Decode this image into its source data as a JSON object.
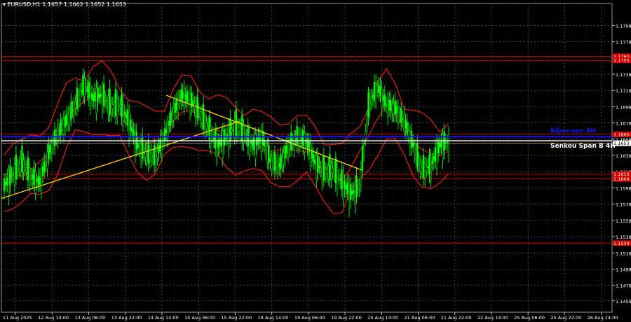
{
  "header": {
    "symbol_line": "EURUSD,H1  1.1657 1.1662 1.1652 1.1653"
  },
  "colors": {
    "background": "#000000",
    "grid": "#6b6b6b",
    "candle": "#00ff00",
    "ichimoku": "#ff1a1a",
    "trendline": "#ffd700",
    "level_red": "#d20000",
    "kijun_blue": "#1414ff",
    "senkou_white": "#ffffff",
    "price_tag": "#ffffff"
  },
  "chart_data": {
    "type": "candlestick",
    "ylim": [
      1.1445,
      1.1825
    ],
    "y_ticks": [
      "1.1798",
      "1.1778",
      "1.1758",
      "1.1738",
      "1.1718",
      "1.1698",
      "1.1678",
      "1.1658",
      "1.1638",
      "1.1618",
      "1.1598",
      "1.1578",
      "1.1558",
      "1.1538",
      "1.1518",
      "1.1498",
      "1.1478",
      "1.1459"
    ],
    "x_labels": [
      "11 Aug 2025",
      "12 Aug 14:00",
      "13 Aug 06:00",
      "13 Aug 22:00",
      "14 Aug 14:00",
      "15 Aug 06:00",
      "15 Aug 22:00",
      "18 Aug 14:00",
      "19 Aug 06:00",
      "19 Aug 22:00",
      "20 Aug 14:00",
      "21 Aug 06:00",
      "21 Aug 22:00",
      "22 Aug 14:00",
      "25 Aug 06:00",
      "25 Aug 22:00",
      "26 Aug 14:00"
    ],
    "close_path": [
      1.16,
      1.1615,
      1.163,
      1.1612,
      1.1605,
      1.164,
      1.1665,
      1.168,
      1.17,
      1.1725,
      1.1708,
      1.1712,
      1.1698,
      1.17,
      1.168,
      1.165,
      1.164,
      1.1635,
      1.166,
      1.169,
      1.1712,
      1.1705,
      1.169,
      1.167,
      1.165,
      1.166,
      1.1675,
      1.1665,
      1.165,
      1.166,
      1.163,
      1.1625,
      1.165,
      1.166,
      1.1655,
      1.1628,
      1.1618,
      1.162,
      1.1605,
      1.159,
      1.16,
      1.17,
      1.1722,
      1.17,
      1.1695,
      1.168,
      1.165,
      1.162,
      1.1625,
      1.165,
      1.1655
    ],
    "levels": [
      {
        "value": 1.176,
        "label": "1.1760",
        "color": "#d20000"
      },
      {
        "value": 1.1755,
        "label": "1.1755",
        "color": "#d20000"
      },
      {
        "value": 1.1664,
        "label": "1.1660",
        "color": "#d20000"
      },
      {
        "value": 1.1615,
        "label": "1.1616",
        "color": "#d20000"
      },
      {
        "value": 1.1609,
        "label": "1.1604",
        "color": "#d20000"
      },
      {
        "value": 1.153,
        "label": "1.1534",
        "color": "#d20000"
      }
    ],
    "indicator_lines": [
      {
        "name": "Kijun-sen 4H",
        "value": 1.1661,
        "color": "#1414ff",
        "label": "Kijun-sen 4H"
      },
      {
        "name": "Senkou Span B 4H",
        "value": 1.1656,
        "color": "#ffffff",
        "label": "Senkou Span B 4H"
      }
    ],
    "current_price": {
      "value": 1.1653,
      "label": "1.1653"
    },
    "trendlines": [
      {
        "x": [
          0.0,
          0.39
        ],
        "y": [
          1.1585,
          1.168
        ]
      },
      {
        "x": [
          0.27,
          0.59
        ],
        "y": [
          1.1712,
          1.162
        ]
      }
    ]
  }
}
